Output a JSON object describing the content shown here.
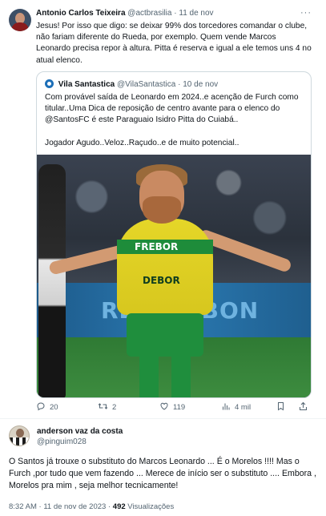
{
  "tweet1": {
    "author_name": "Antonio Carlos Teixeira",
    "author_handle": "@actbrasilia",
    "separator": "·",
    "date": "11 de nov",
    "more": "···",
    "text": "Jesus! Por isso que digo: se deixar 99% dos torcedores comandar o clube, não fariam diferente do Rueda, por exemplo. Quem vende Marcos Leonardo precisa repor à altura. Pitta é reserva e igual a ele temos uns 4 no atual elenco.",
    "quote": {
      "author_name": "Vila Santastica",
      "author_handle": "@VilaSantastica",
      "date": "10 de nov",
      "text_lines": [
        "Com provável saída de Leonardo em 2024..e acenção de Furch como titular..Uma Dica de reposição de centro avante para o elenco do @SantosFC é este Paraguaio Isidro Pitta do Cuiabá..",
        "Jogador Agudo..Veloz..Raçudo..e de muito potencial.."
      ],
      "image": {
        "board_text": "RE$ 30 BON",
        "sponsor_top": "FREBOR",
        "sponsor_bottom": "DEBOR"
      }
    },
    "actions": {
      "reply_count": "20",
      "retweet_count": "2",
      "like_count": "119",
      "views_count": "4 mil"
    }
  },
  "tweet2": {
    "author_name": "anderson vaz da costa",
    "author_handle": "@pinguim028",
    "text": "O Santos já trouxe o substituto do Marcos Leonardo ... É o Morelos !!!! Mas o Furch ,por tudo que vem fazendo ... Merece de início ser o substituto .... Embora , Morelos pra mim , seja melhor tecnicamente!",
    "time": "8:32 AM",
    "date": "11 de nov de 2023",
    "views": "492",
    "views_label": "Visualizações"
  },
  "colors": {
    "text": "#0f1419",
    "muted": "#536471",
    "border": "#cfd9de"
  },
  "icons": [
    "more-icon",
    "reply-icon",
    "retweet-icon",
    "like-icon",
    "views-icon",
    "bookmark-icon",
    "share-icon"
  ]
}
